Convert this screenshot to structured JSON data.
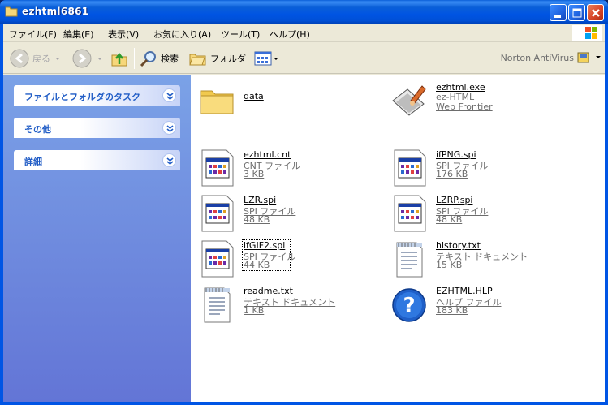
{
  "window": {
    "title": "ezhtml6861"
  },
  "menu": [
    {
      "label": "ファイル(F)"
    },
    {
      "label": "編集(E)"
    },
    {
      "label": "表示(V)"
    },
    {
      "label": "お気に入り(A)"
    },
    {
      "label": "ツール(T)"
    },
    {
      "label": "ヘルプ(H)"
    }
  ],
  "toolbar": {
    "back": "戻る",
    "search": "検索",
    "folders": "フォルダ",
    "norton": "Norton AntiVirus"
  },
  "tasks": [
    {
      "label": "ファイルとフォルダのタスク"
    },
    {
      "label": "その他"
    },
    {
      "label": "詳細"
    }
  ],
  "files": [
    {
      "name": "data",
      "type": "",
      "size": "",
      "icon": "folder-icon"
    },
    {
      "name": "ezhtml.exe",
      "type": "ez-HTML",
      "size": "Web Frontier",
      "icon": "exe-icon"
    },
    {
      "name": "ezhtml.cnt",
      "type": "CNT ファイル",
      "size": "3 KB",
      "icon": "window-file-icon"
    },
    {
      "name": "ifPNG.spi",
      "type": "SPI ファイル",
      "size": "176 KB",
      "icon": "window-file-icon"
    },
    {
      "name": "LZR.spi",
      "type": "SPI ファイル",
      "size": "48 KB",
      "icon": "window-file-icon"
    },
    {
      "name": "LZRP.spi",
      "type": "SPI ファイル",
      "size": "48 KB",
      "icon": "window-file-icon"
    },
    {
      "name": "ifGIF2.spi",
      "type": "SPI ファイル",
      "size": "44 KB",
      "icon": "window-file-icon"
    },
    {
      "name": "history.txt",
      "type": "テキスト ドキュメント",
      "size": "15 KB",
      "icon": "text-document-icon"
    },
    {
      "name": "readme.txt",
      "type": "テキスト ドキュメント",
      "size": "1 KB",
      "icon": "text-document-icon"
    },
    {
      "name": "EZHTML.HLP",
      "type": "ヘルプ ファイル",
      "size": "183 KB",
      "icon": "help-file-icon"
    }
  ],
  "colors": {
    "titlebar": "#0054e3",
    "taskpane_top": "#7ba2e7",
    "taskpane_bottom": "#6375d6",
    "task_title": "#215dc6"
  }
}
